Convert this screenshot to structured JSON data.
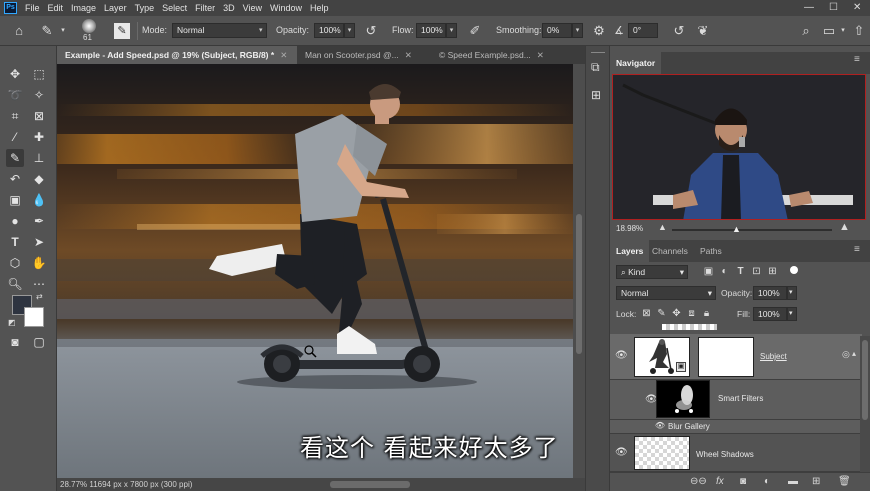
{
  "menubar": {
    "logo": "Ps",
    "items": [
      "File",
      "Edit",
      "Image",
      "Layer",
      "Type",
      "Select",
      "Filter",
      "3D",
      "View",
      "Window",
      "Help"
    ]
  },
  "options": {
    "brush_size": "61",
    "mode_label": "Mode:",
    "mode_value": "Normal",
    "opacity_label": "Opacity:",
    "opacity_value": "100%",
    "flow_label": "Flow:",
    "flow_value": "100%",
    "smoothing_label": "Smoothing:",
    "smoothing_value": "0%",
    "angle_value": "0°"
  },
  "tabs": [
    {
      "label": "Example - Add Speed.psd @ 19% (Subject, RGB/8) *"
    },
    {
      "label": "Man on Scooter.psd @..."
    },
    {
      "label": "© Speed Example.psd..."
    }
  ],
  "navigator": {
    "title": "Navigator",
    "zoom": "18.98%"
  },
  "layers_panel": {
    "tabs": [
      "Layers",
      "Channels",
      "Paths"
    ],
    "filter_kind": "Kind",
    "blend_mode": "Normal",
    "opacity_label": "Opacity:",
    "opacity_value": "100%",
    "lock_label": "Lock:",
    "fill_label": "Fill:",
    "fill_value": "100%",
    "layers": [
      {
        "name": "Subject"
      },
      {
        "name": "Smart Filters"
      },
      {
        "name": "Blur Gallery"
      },
      {
        "name": "Wheel Shadows"
      }
    ]
  },
  "status": {
    "text": "28.77%  11694 px x 7800 px (300 ppi)"
  },
  "subtitle": "看这个 看起来好太多了",
  "colors": {
    "foreground": "#2e3440",
    "background": "#ffffff",
    "accent": "#31a8ff"
  }
}
